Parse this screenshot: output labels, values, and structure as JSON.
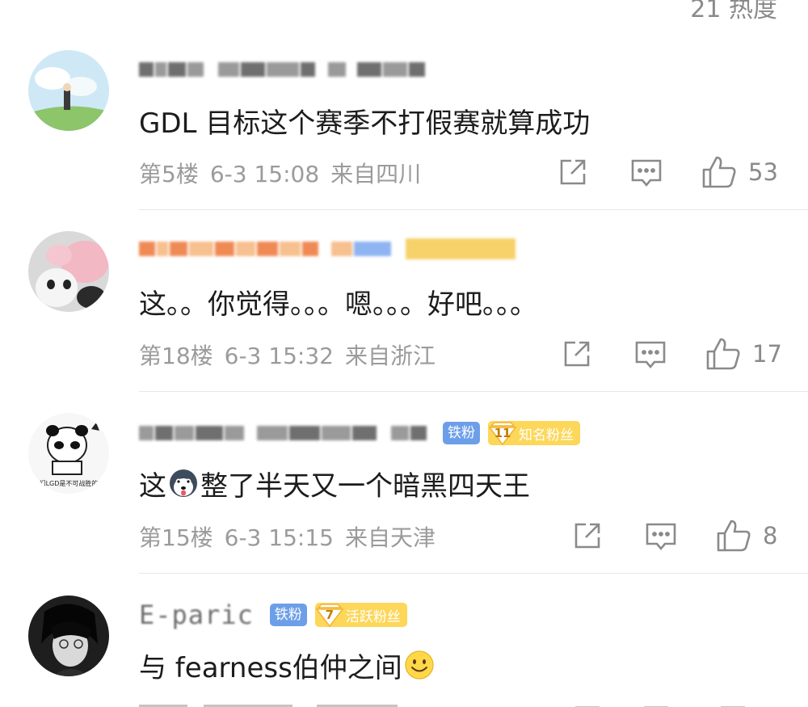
{
  "header": {
    "partial_text": "21 热度"
  },
  "comments": [
    {
      "content": "GDL 目标这个赛季不打假赛就算成功",
      "floor": "第5楼",
      "time": "6-3 15:08",
      "location": "来自四川",
      "likes": "53"
    },
    {
      "content": "这。。你觉得。。。嗯。。。好吧。。。",
      "floor": "第18楼",
      "time": "6-3 15:32",
      "location": "来自浙江",
      "likes": "17"
    },
    {
      "content_before": "这",
      "content_after": "整了半天又一个暗黑四天王",
      "avatar_caption": "们LGD是不可战胜的",
      "badge_iron": "铁粉",
      "badge_level": "11",
      "badge_fan": "知名粉丝",
      "floor": "第15楼",
      "time": "6-3 15:15",
      "location": "来自天津",
      "likes": "8"
    },
    {
      "username": "E-paric",
      "content": "与 fearness伯仲之间",
      "badge_iron": "铁粉",
      "badge_level": "7",
      "badge_fan": "活跃粉丝"
    }
  ],
  "icons": [
    "share-icon",
    "reply-icon",
    "like-icon",
    "smile-emoji-icon",
    "husky-emoji-icon"
  ],
  "colors": {
    "accent_blue": "#6d9fe8",
    "badge_yellow": "#fcd75a",
    "meta_gray": "#9b9b9b",
    "text": "#1c1c1c"
  }
}
